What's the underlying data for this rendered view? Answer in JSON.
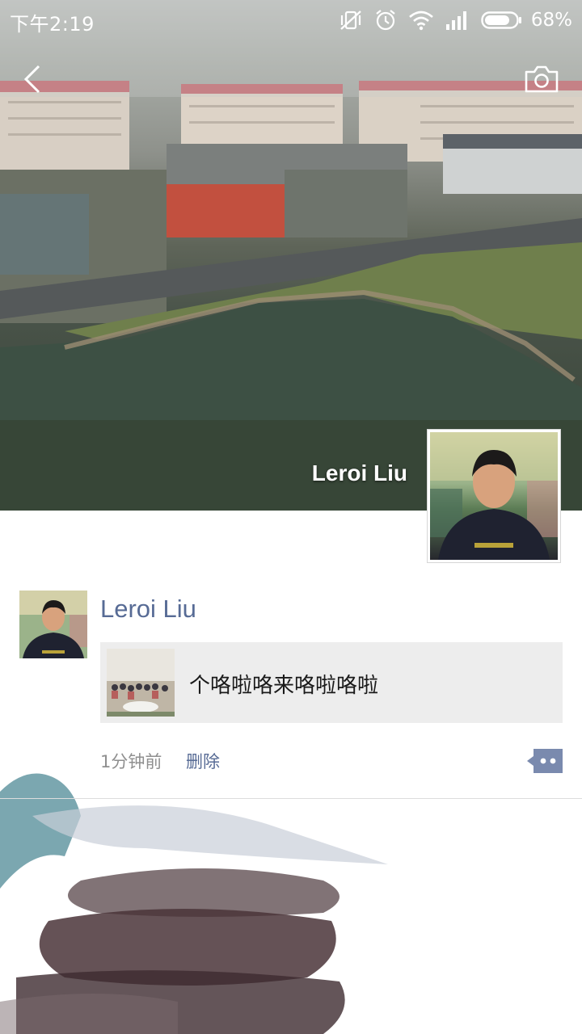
{
  "status_bar": {
    "time": "下午2:19",
    "battery_percent": "68%",
    "icons": [
      "vibrate-off-icon",
      "alarm-icon",
      "wifi-icon",
      "signal-icon",
      "battery-icon"
    ]
  },
  "header": {
    "back_icon": "chevron-left-icon",
    "camera_icon": "camera-icon"
  },
  "profile": {
    "cover_name": "Leroi Liu"
  },
  "post": {
    "author": "Leroi Liu",
    "link_title": "个咯啦咯来咯啦咯啦",
    "time": "1分钟前",
    "delete_label": "删除",
    "more_icon": "comment-more-icon"
  },
  "colors": {
    "link_blue": "#576b95",
    "card_bg": "#ededed",
    "meta_gray": "#8f8f8f"
  }
}
